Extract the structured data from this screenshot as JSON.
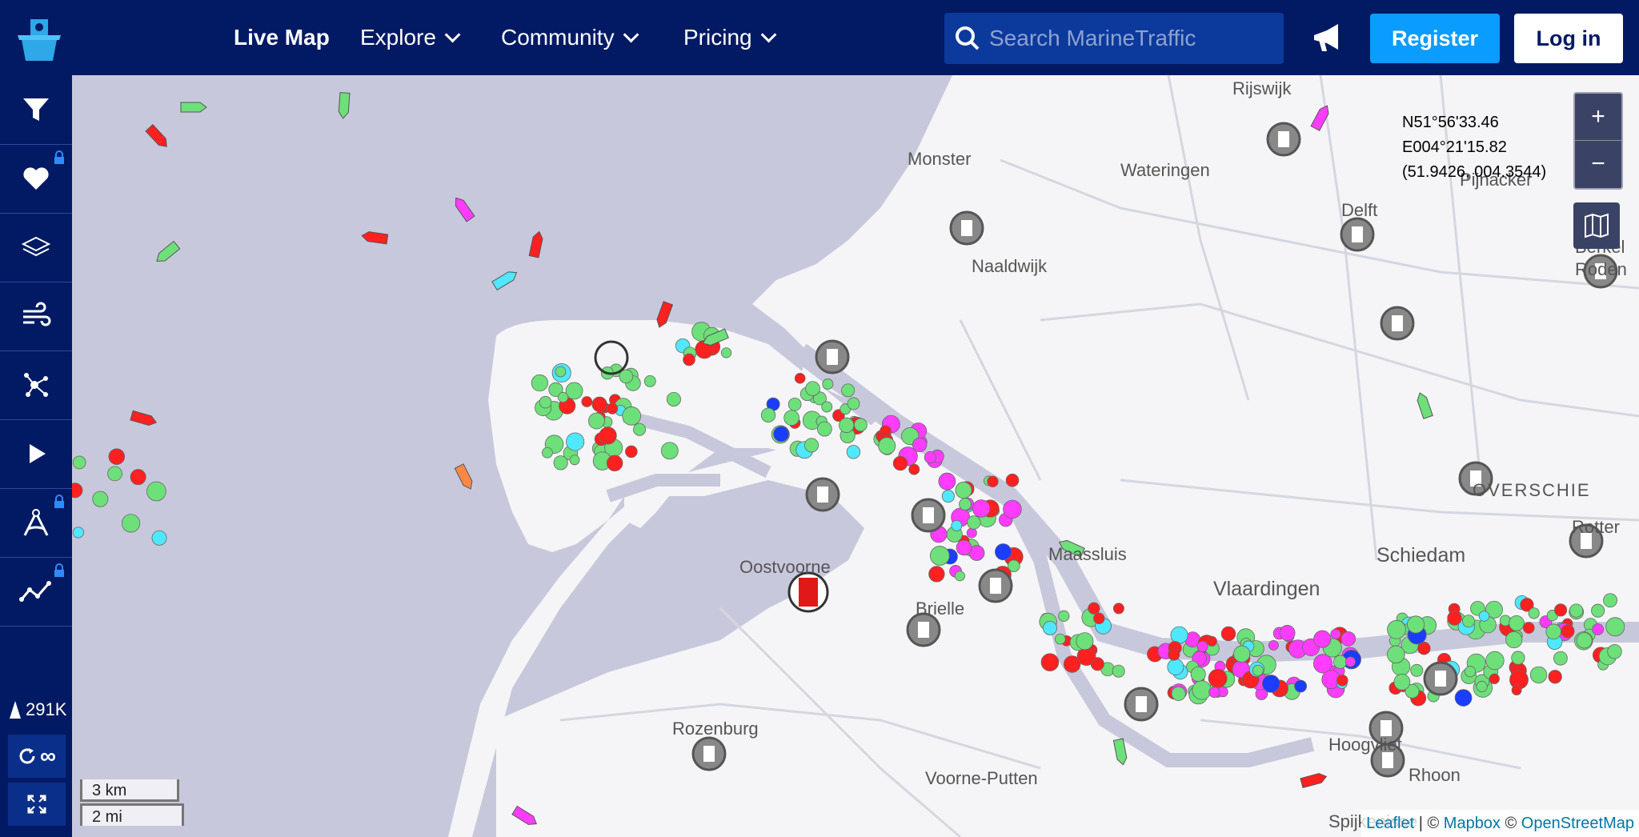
{
  "nav": {
    "live_map": "Live Map",
    "explore": "Explore",
    "community": "Community",
    "pricing": "Pricing",
    "search_placeholder": "Search MarineTraffic",
    "register": "Register",
    "login": "Log in"
  },
  "sidebar": {
    "items": [
      "filter-icon",
      "favorites-icon",
      "layers-icon",
      "weather-icon",
      "density-icon",
      "playback-icon",
      "measure-icon",
      "route-icon"
    ],
    "vessel_count": "291K",
    "loop_label": "∞"
  },
  "zoom": {
    "in": "+",
    "out": "−"
  },
  "coordinates": {
    "lat": "N51°56'33.46",
    "lon": "E004°21'15.82",
    "decimal": "(51.9426, 004.3544)"
  },
  "scale": {
    "km": "3 km",
    "mi": "2 mi"
  },
  "attribution": {
    "leaflet": "Leaflet",
    "sep": " | © ",
    "mapbox": "Mapbox",
    "osm": "OpenStreetMap",
    "copy": " © "
  },
  "places": [
    {
      "name": "Rijswijk"
    },
    {
      "name": "Monster"
    },
    {
      "name": "Wateringen"
    },
    {
      "name": "Pijnacker"
    },
    {
      "name": "Delft"
    },
    {
      "name": "Naaldwijk"
    },
    {
      "name": "Berkel"
    },
    {
      "name": "Roden"
    },
    {
      "name": "OVERSCHIE"
    },
    {
      "name": "Rotter"
    },
    {
      "name": "Schiedam"
    },
    {
      "name": "Maassluis"
    },
    {
      "name": "Vlaardingen"
    },
    {
      "name": "Oostvoorne"
    },
    {
      "name": "Brielle"
    },
    {
      "name": "Rozenburg"
    },
    {
      "name": "Hoogvliet"
    },
    {
      "name": "Voorne-Putten"
    },
    {
      "name": "Rhoon"
    },
    {
      "name": "Spijkenisse"
    }
  ],
  "colors": {
    "sea": "#c8c8dc",
    "land": "#f5f5f7",
    "nav": "#021a63",
    "register": "#0a9dff",
    "vessel_green": "#6de07a",
    "vessel_red": "#ff2020",
    "vessel_cyan": "#4fe8ff",
    "vessel_blue": "#1a3dff",
    "vessel_magenta": "#ff3cff"
  }
}
